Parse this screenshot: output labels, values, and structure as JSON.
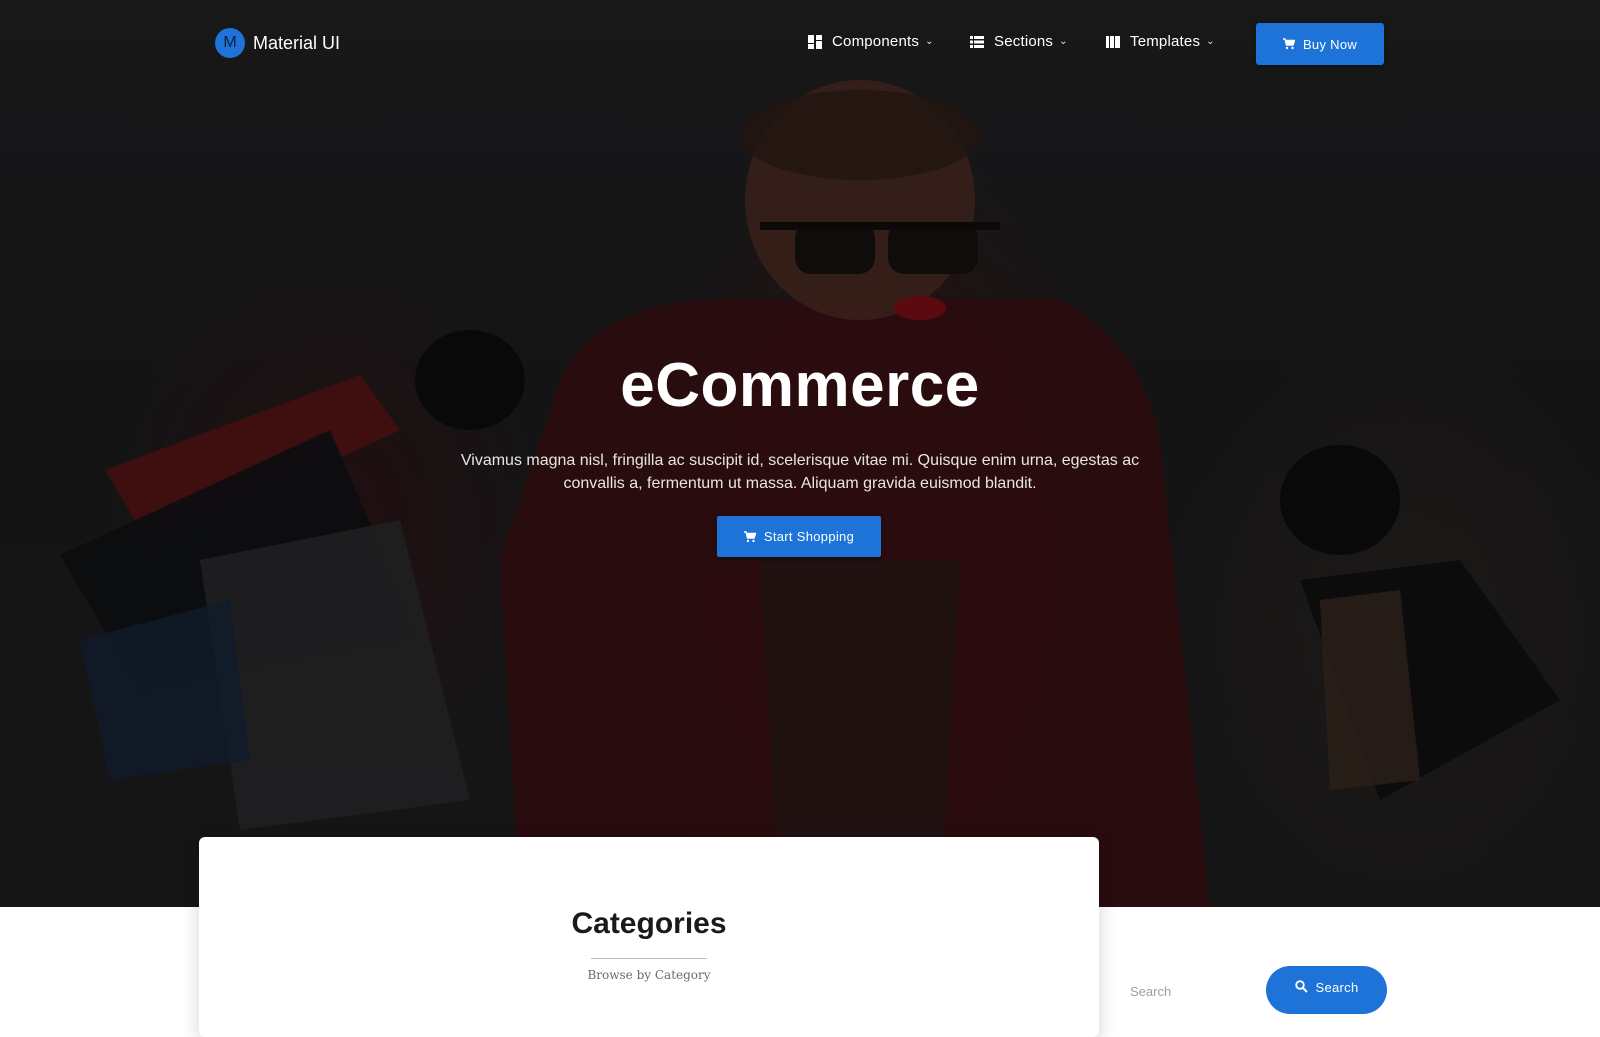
{
  "navbar": {
    "brand_initial": "M",
    "brand_name": "Material UI",
    "items": [
      {
        "label": "Components",
        "icon": "dashboard-icon"
      },
      {
        "label": "Sections",
        "icon": "list-icon"
      },
      {
        "label": "Templates",
        "icon": "view-column-icon"
      }
    ],
    "buy_label": "Buy Now"
  },
  "hero": {
    "title": "eCommerce",
    "description": "Vivamus magna nisl, fringilla ac suscipit id, scelerisque vitae mi. Quisque enim urna, egestas ac convallis a, fermentum ut massa. Aliquam gravida euismod blandit.",
    "cta_label": "Start Shopping"
  },
  "categories": {
    "title": "Categories",
    "subtitle": "Browse by Category"
  },
  "search": {
    "placeholder": "Search",
    "button_label": "Search"
  },
  "colors": {
    "primary": "#1e73d8",
    "hero_bg": "#1e1d1e"
  }
}
